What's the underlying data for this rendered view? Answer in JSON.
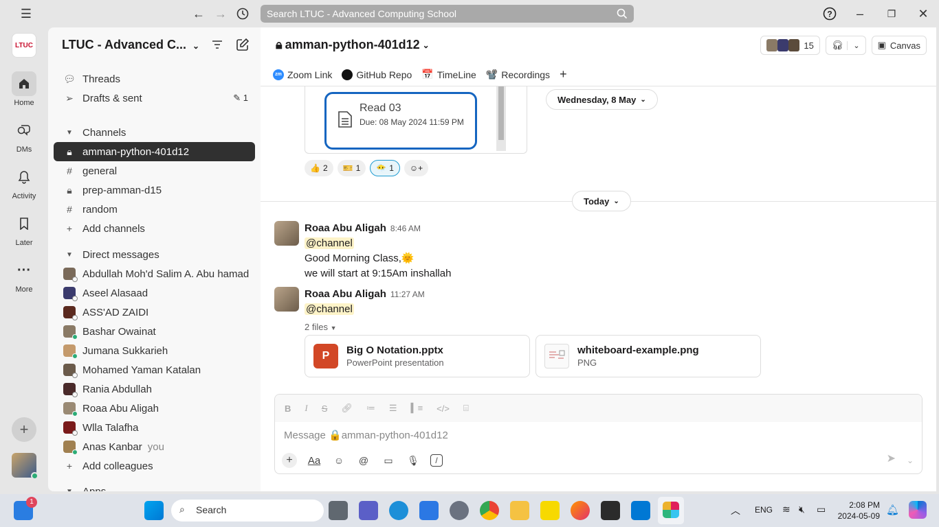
{
  "titlebar": {
    "search_text": "Search LTUC - Advanced Computing School"
  },
  "rail": {
    "workspace_logo": "LTUC",
    "items": [
      {
        "label": "Home"
      },
      {
        "label": "DMs"
      },
      {
        "label": "Activity"
      },
      {
        "label": "Later"
      },
      {
        "label": "More"
      }
    ]
  },
  "sidebar": {
    "workspace_name": "LTUC - Advanced C...",
    "threads": "Threads",
    "drafts": "Drafts & sent",
    "drafts_count": "1",
    "channels_header": "Channels",
    "channels": [
      {
        "name": "amman-python-401d12",
        "private": true
      },
      {
        "name": "general",
        "private": false
      },
      {
        "name": "prep-amman-d15",
        "private": true
      },
      {
        "name": "random",
        "private": false
      }
    ],
    "add_channels": "Add channels",
    "dm_header": "Direct messages",
    "dms": [
      {
        "name": "Abdullah Moh'd Salim A. Abu hamad",
        "color": "#7a6a5a",
        "status": "away"
      },
      {
        "name": "Aseel Alasaad",
        "color": "#3b3b6d",
        "status": "away"
      },
      {
        "name": "ASS'AD ZAIDI",
        "color": "#5b2a1f",
        "status": "away"
      },
      {
        "name": "Bashar Owainat",
        "color": "#8a7a66",
        "status": "online"
      },
      {
        "name": "Jumana Sukkarieh",
        "color": "#c49a6c",
        "status": "online"
      },
      {
        "name": "Mohamed Yaman Katalan",
        "color": "#6b5b4b",
        "status": "away"
      },
      {
        "name": "Rania Abdullah",
        "color": "#4a2a2a",
        "status": "away"
      },
      {
        "name": "Roaa Abu Aligah",
        "color": "#9a8a74",
        "status": "online"
      },
      {
        "name": "Wlla Talafha",
        "color": "#7a1a1a",
        "status": "away"
      },
      {
        "name": "Anas Kanbar",
        "color": "#a08050",
        "status": "online",
        "you": "you"
      }
    ],
    "add_colleagues": "Add colleagues",
    "apps_header": "Apps"
  },
  "channel": {
    "name": "amman-python-401d12",
    "member_count": "15",
    "canvas_label": "Canvas",
    "tabs": [
      {
        "label": "Zoom Link",
        "icon": "zoom-icon"
      },
      {
        "label": "GitHub Repo",
        "icon": "github-icon"
      },
      {
        "label": "TimeLine",
        "icon": "calendar-icon"
      },
      {
        "label": "Recordings",
        "icon": "recording-icon"
      }
    ]
  },
  "assignment": {
    "title": "Read 03",
    "due": "Due: 08 May 2024 11:59 PM"
  },
  "reactions": [
    {
      "emoji": "👍",
      "count": "2"
    },
    {
      "emoji": "🎫",
      "count": "1"
    },
    {
      "emoji": "😶‍🌫️",
      "count": "1"
    }
  ],
  "date_dividers": {
    "first": "Wednesday, 8 May",
    "second": "Today"
  },
  "messages": [
    {
      "author": "Roaa Abu Aligah",
      "time": "8:46 AM",
      "mention": "@channel",
      "line1": "Good Morning Class,🌞",
      "line2": "we will start at 9:15Am inshallah"
    },
    {
      "author": "Roaa Abu Aligah",
      "time": "11:27 AM",
      "mention": "@channel",
      "files_label": "2 files"
    }
  ],
  "files": [
    {
      "name": "Big O Notation.pptx",
      "type": "PowerPoint presentation",
      "badge": "P"
    },
    {
      "name": "whiteboard-example.png",
      "type": "PNG"
    }
  ],
  "composer": {
    "placeholder": "Message 🔒amman-python-401d12",
    "aa": "Aa"
  },
  "taskbar": {
    "search": "Search",
    "lang": "ENG",
    "time": "2:08 PM",
    "date": "2024-05-09",
    "notif_badge": "1"
  }
}
